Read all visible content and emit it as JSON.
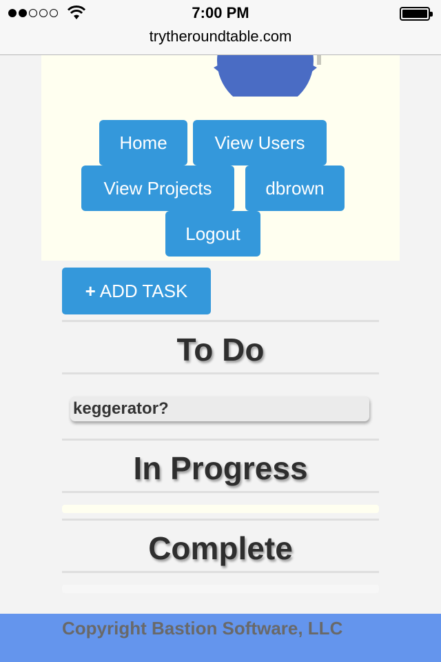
{
  "status_bar": {
    "time": "7:00 PM",
    "url": "trytheroundtable.com"
  },
  "nav": {
    "home": "Home",
    "view_users": "View Users",
    "view_projects": "View Projects",
    "user": "dbrown",
    "logout": "Logout"
  },
  "main": {
    "add_task_plus": "+",
    "add_task_label": "ADD TASK",
    "sections": {
      "todo": "To Do",
      "in_progress": "In Progress",
      "complete": "Complete"
    },
    "todo_tasks": [
      "keggerator?"
    ]
  },
  "footer": {
    "copyright": "Copyright Bastion Software, LLC"
  },
  "colors": {
    "button": "#3498db",
    "header_bg": "#fffff0",
    "footer_bg": "#6495ed",
    "page_bg": "#f3f3f3",
    "logo": "#4a6cc4"
  }
}
